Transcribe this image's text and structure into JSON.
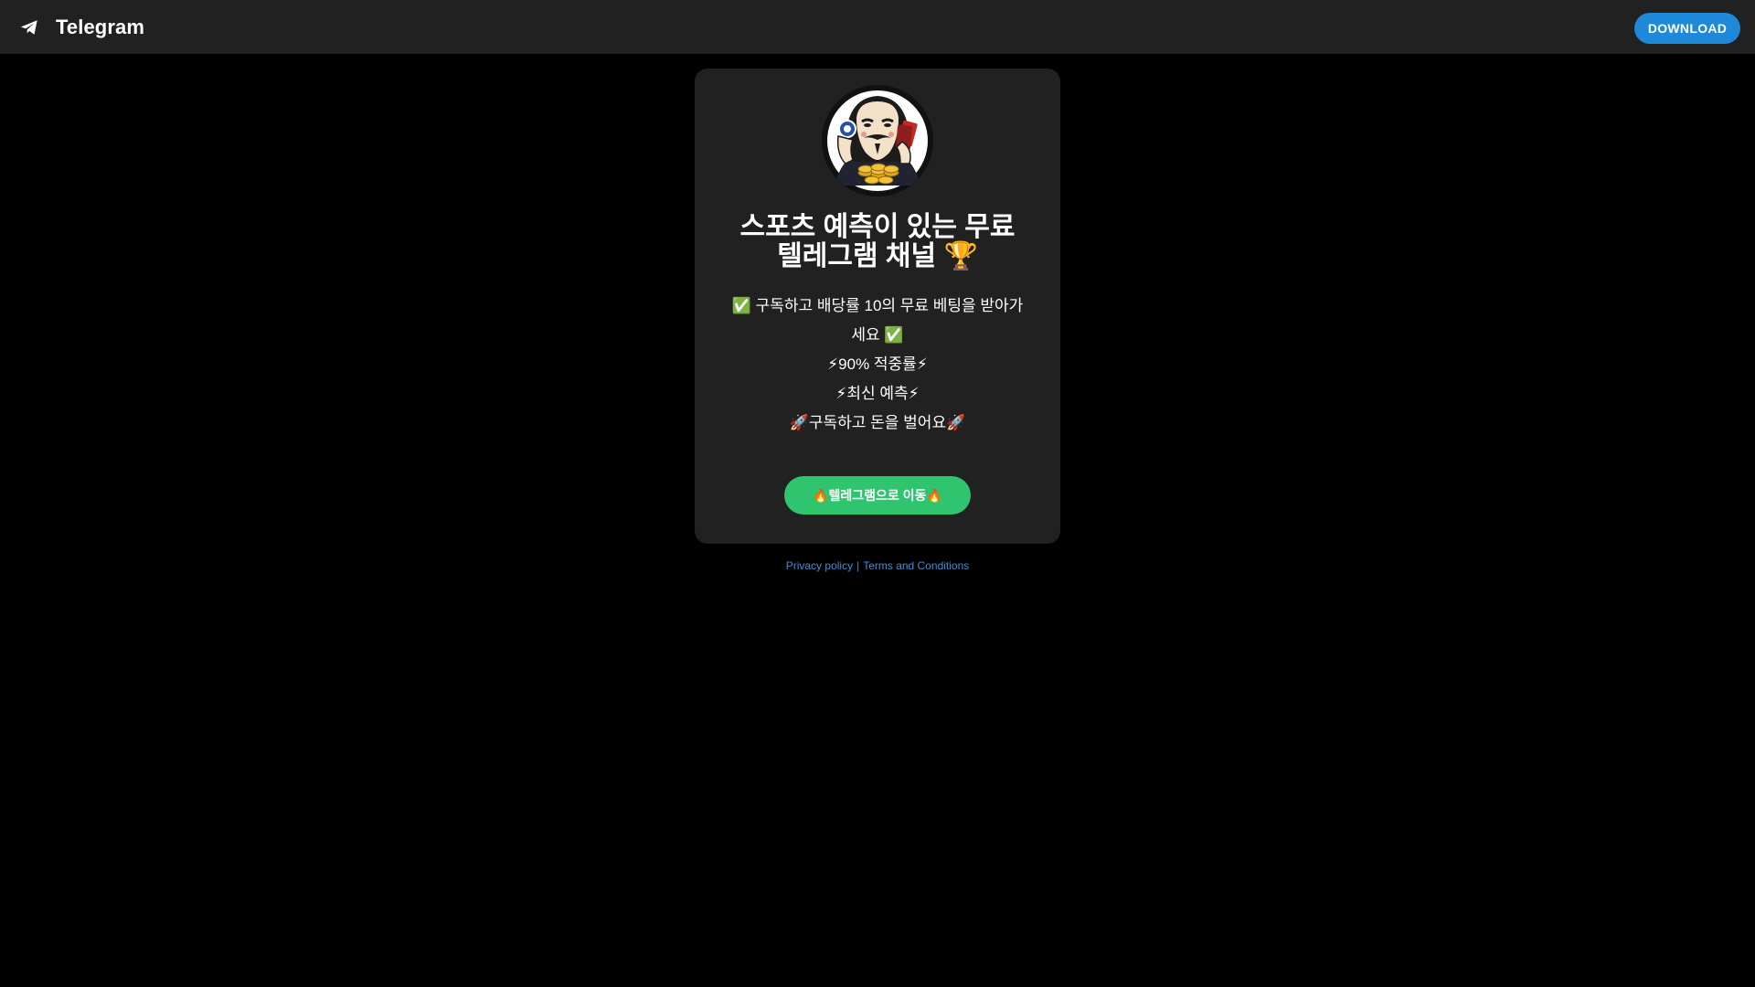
{
  "header": {
    "app_name": "Telegram",
    "logo_icon": "telegram-plane-icon",
    "download_label": "DOWNLOAD"
  },
  "channel": {
    "avatar_icon": "masked-gambler-avatar",
    "title": "스포츠 예측이 있는 무료\n텔레그램 채널 🏆",
    "description": [
      "✅ 구독하고 배당률 10의 무료 베팅을 받아가세요 ✅",
      "⚡90% 적중률⚡",
      "⚡최신 예측⚡",
      "🚀구독하고 돈을 벌어요🚀"
    ],
    "cta_label": "🔥텔레그램으로 이동🔥"
  },
  "footer": {
    "privacy_label": "Privacy policy",
    "separator": "|",
    "terms_label": "Terms and Conditions"
  },
  "colors": {
    "topbar_bg": "#212121",
    "page_bg": "#000000",
    "card_bg": "#212121",
    "download_button": "#1e88d9",
    "cta_button": "#2fc56f",
    "link": "#3a8fd6"
  }
}
